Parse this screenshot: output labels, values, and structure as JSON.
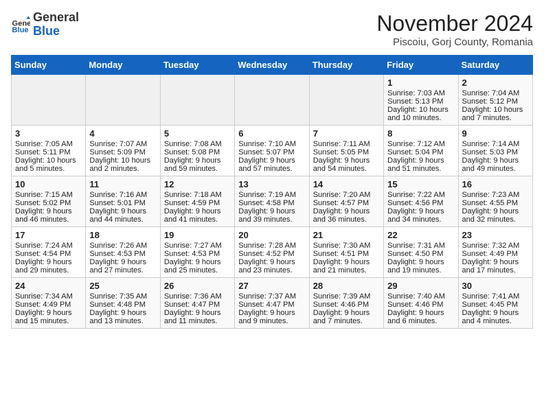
{
  "header": {
    "logo_general": "General",
    "logo_blue": "Blue",
    "month_title": "November 2024",
    "subtitle": "Piscoiu, Gorj County, Romania"
  },
  "days_of_week": [
    "Sunday",
    "Monday",
    "Tuesday",
    "Wednesday",
    "Thursday",
    "Friday",
    "Saturday"
  ],
  "weeks": [
    [
      {
        "day": "",
        "info": ""
      },
      {
        "day": "",
        "info": ""
      },
      {
        "day": "",
        "info": ""
      },
      {
        "day": "",
        "info": ""
      },
      {
        "day": "",
        "info": ""
      },
      {
        "day": "1",
        "info": "Sunrise: 7:03 AM\nSunset: 5:13 PM\nDaylight: 10 hours and 10 minutes."
      },
      {
        "day": "2",
        "info": "Sunrise: 7:04 AM\nSunset: 5:12 PM\nDaylight: 10 hours and 7 minutes."
      }
    ],
    [
      {
        "day": "3",
        "info": "Sunrise: 7:05 AM\nSunset: 5:11 PM\nDaylight: 10 hours and 5 minutes."
      },
      {
        "day": "4",
        "info": "Sunrise: 7:07 AM\nSunset: 5:09 PM\nDaylight: 10 hours and 2 minutes."
      },
      {
        "day": "5",
        "info": "Sunrise: 7:08 AM\nSunset: 5:08 PM\nDaylight: 9 hours and 59 minutes."
      },
      {
        "day": "6",
        "info": "Sunrise: 7:10 AM\nSunset: 5:07 PM\nDaylight: 9 hours and 57 minutes."
      },
      {
        "day": "7",
        "info": "Sunrise: 7:11 AM\nSunset: 5:05 PM\nDaylight: 9 hours and 54 minutes."
      },
      {
        "day": "8",
        "info": "Sunrise: 7:12 AM\nSunset: 5:04 PM\nDaylight: 9 hours and 51 minutes."
      },
      {
        "day": "9",
        "info": "Sunrise: 7:14 AM\nSunset: 5:03 PM\nDaylight: 9 hours and 49 minutes."
      }
    ],
    [
      {
        "day": "10",
        "info": "Sunrise: 7:15 AM\nSunset: 5:02 PM\nDaylight: 9 hours and 46 minutes."
      },
      {
        "day": "11",
        "info": "Sunrise: 7:16 AM\nSunset: 5:01 PM\nDaylight: 9 hours and 44 minutes."
      },
      {
        "day": "12",
        "info": "Sunrise: 7:18 AM\nSunset: 4:59 PM\nDaylight: 9 hours and 41 minutes."
      },
      {
        "day": "13",
        "info": "Sunrise: 7:19 AM\nSunset: 4:58 PM\nDaylight: 9 hours and 39 minutes."
      },
      {
        "day": "14",
        "info": "Sunrise: 7:20 AM\nSunset: 4:57 PM\nDaylight: 9 hours and 36 minutes."
      },
      {
        "day": "15",
        "info": "Sunrise: 7:22 AM\nSunset: 4:56 PM\nDaylight: 9 hours and 34 minutes."
      },
      {
        "day": "16",
        "info": "Sunrise: 7:23 AM\nSunset: 4:55 PM\nDaylight: 9 hours and 32 minutes."
      }
    ],
    [
      {
        "day": "17",
        "info": "Sunrise: 7:24 AM\nSunset: 4:54 PM\nDaylight: 9 hours and 29 minutes."
      },
      {
        "day": "18",
        "info": "Sunrise: 7:26 AM\nSunset: 4:53 PM\nDaylight: 9 hours and 27 minutes."
      },
      {
        "day": "19",
        "info": "Sunrise: 7:27 AM\nSunset: 4:53 PM\nDaylight: 9 hours and 25 minutes."
      },
      {
        "day": "20",
        "info": "Sunrise: 7:28 AM\nSunset: 4:52 PM\nDaylight: 9 hours and 23 minutes."
      },
      {
        "day": "21",
        "info": "Sunrise: 7:30 AM\nSunset: 4:51 PM\nDaylight: 9 hours and 21 minutes."
      },
      {
        "day": "22",
        "info": "Sunrise: 7:31 AM\nSunset: 4:50 PM\nDaylight: 9 hours and 19 minutes."
      },
      {
        "day": "23",
        "info": "Sunrise: 7:32 AM\nSunset: 4:49 PM\nDaylight: 9 hours and 17 minutes."
      }
    ],
    [
      {
        "day": "24",
        "info": "Sunrise: 7:34 AM\nSunset: 4:49 PM\nDaylight: 9 hours and 15 minutes."
      },
      {
        "day": "25",
        "info": "Sunrise: 7:35 AM\nSunset: 4:48 PM\nDaylight: 9 hours and 13 minutes."
      },
      {
        "day": "26",
        "info": "Sunrise: 7:36 AM\nSunset: 4:47 PM\nDaylight: 9 hours and 11 minutes."
      },
      {
        "day": "27",
        "info": "Sunrise: 7:37 AM\nSunset: 4:47 PM\nDaylight: 9 hours and 9 minutes."
      },
      {
        "day": "28",
        "info": "Sunrise: 7:39 AM\nSunset: 4:46 PM\nDaylight: 9 hours and 7 minutes."
      },
      {
        "day": "29",
        "info": "Sunrise: 7:40 AM\nSunset: 4:46 PM\nDaylight: 9 hours and 6 minutes."
      },
      {
        "day": "30",
        "info": "Sunrise: 7:41 AM\nSunset: 4:45 PM\nDaylight: 9 hours and 4 minutes."
      }
    ]
  ]
}
